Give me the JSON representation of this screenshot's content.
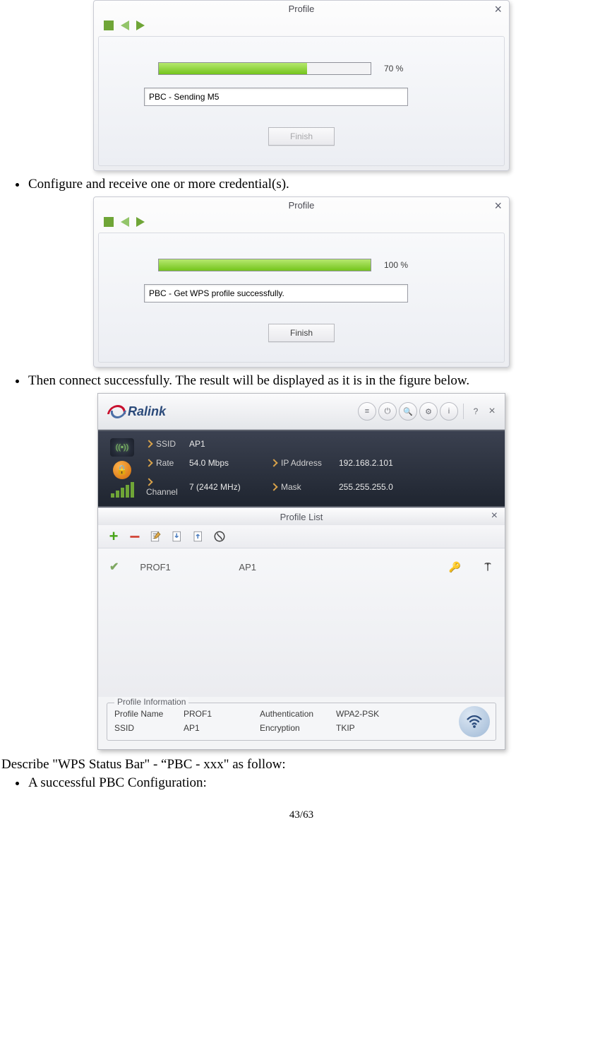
{
  "dialog1": {
    "title": "Profile",
    "progress_percent": 70,
    "progress_label": "70 %",
    "status": "PBC - Sending M5",
    "finish_label": "Finish",
    "finish_enabled": false
  },
  "bullets": {
    "b1": "Configure and receive one or more credential(s).",
    "b2": "Then connect successfully. The result will be displayed as it is in the figure below.",
    "b3": "A successful PBC Configuration:"
  },
  "dialog2": {
    "title": "Profile",
    "progress_percent": 100,
    "progress_label": "100 %",
    "status": "PBC - Get WPS profile successfully.",
    "finish_label": "Finish",
    "finish_enabled": true
  },
  "ralink": {
    "brand": "Ralink",
    "status": {
      "labels": {
        "ssid": "SSID",
        "rate": "Rate",
        "channel": "Channel",
        "ip": "IP Address",
        "mask": "Mask"
      },
      "values": {
        "ssid": "AP1",
        "rate": "54.0 Mbps",
        "channel": "7 (2442 MHz)",
        "ip": "192.168.2.101",
        "mask": "255.255.255.0"
      }
    },
    "profile_list": {
      "title": "Profile List",
      "row": {
        "name": "PROF1",
        "ap": "AP1"
      },
      "info_legend": "Profile Information",
      "info": {
        "profile_name_label": "Profile Name",
        "profile_name": "PROF1",
        "auth_label": "Authentication",
        "auth": "WPA2-PSK",
        "ssid_label": "SSID",
        "ssid": "AP1",
        "enc_label": "Encryption",
        "enc": "TKIP"
      }
    }
  },
  "para": "Describe \"WPS Status Bar\" - “PBC - xxx\" as follow:",
  "page": "43/63"
}
